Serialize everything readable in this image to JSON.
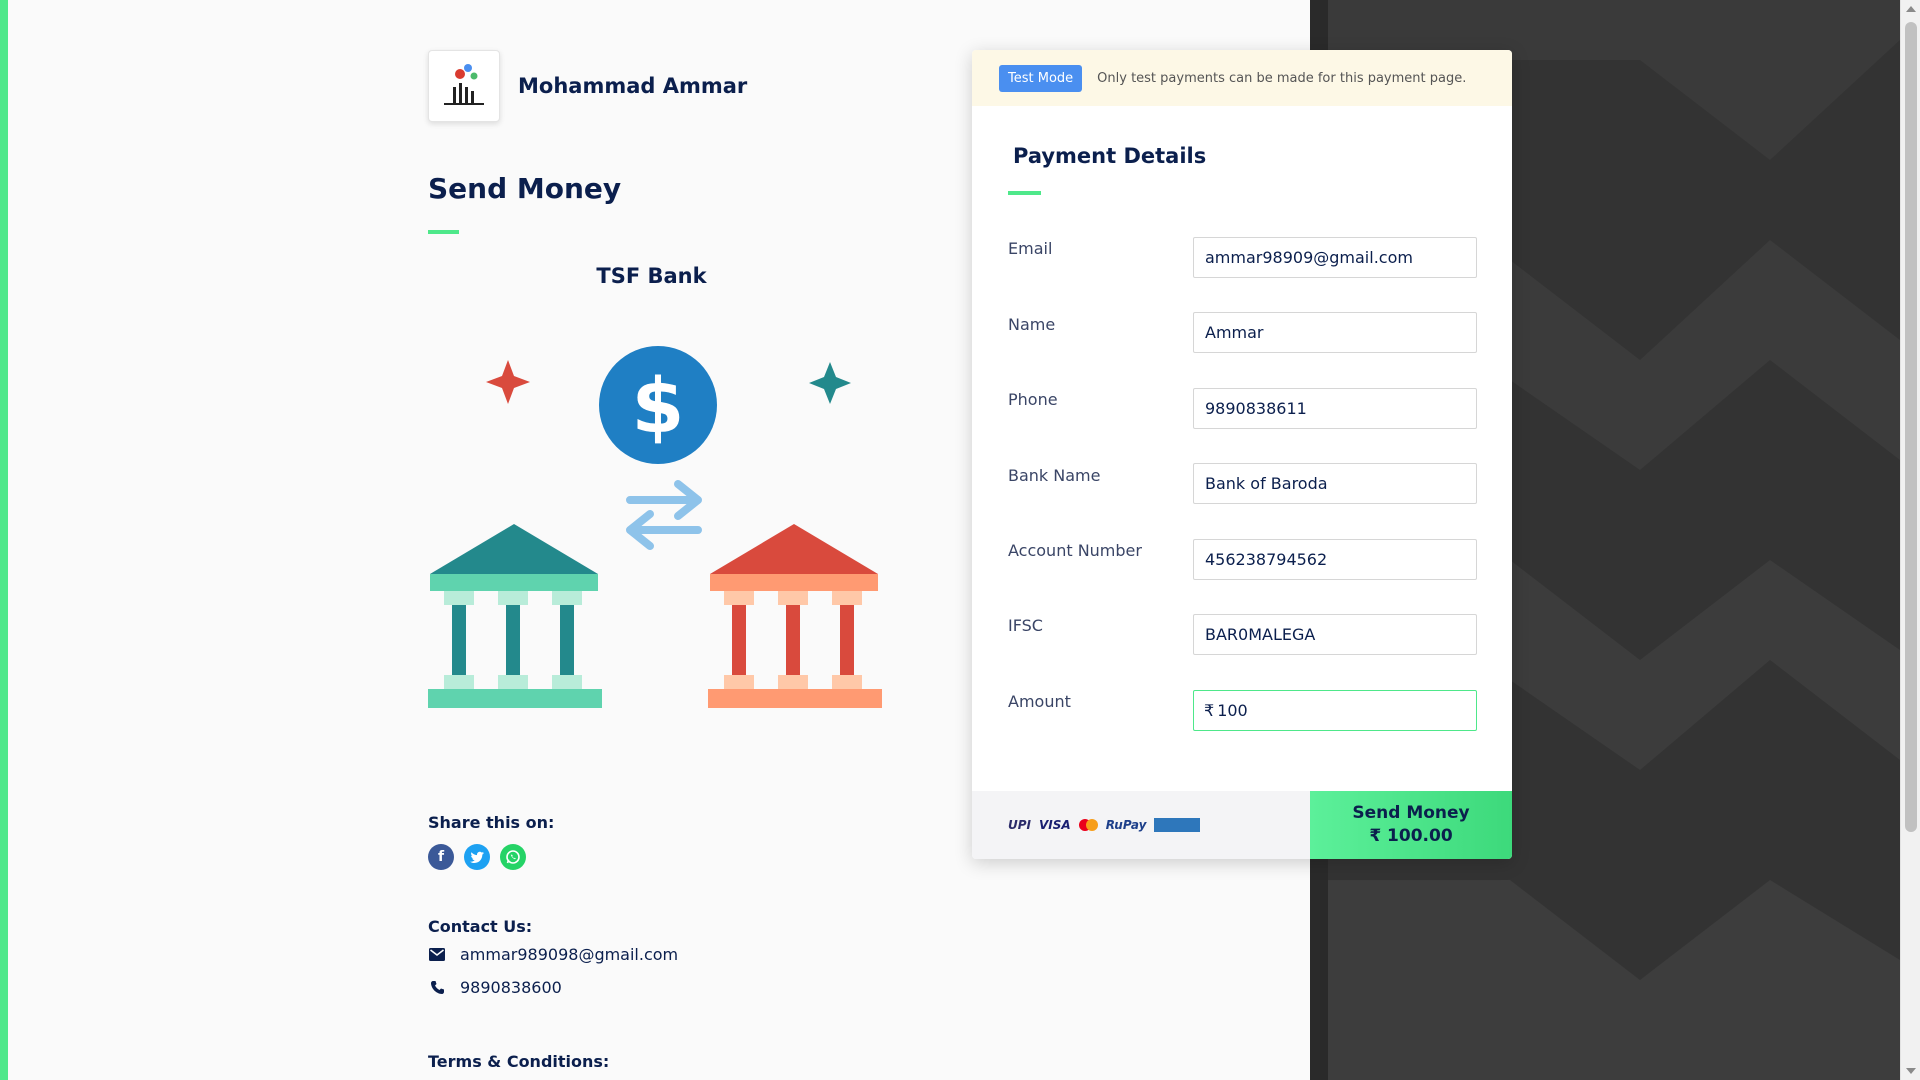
{
  "merchant": {
    "name": "Mohammad Ammar"
  },
  "page": {
    "title": "Send Money",
    "bank_name": "TSF Bank"
  },
  "share": {
    "label": "Share this on:",
    "icons": [
      "facebook-icon",
      "twitter-icon",
      "whatsapp-icon"
    ]
  },
  "contact": {
    "label": "Contact Us:",
    "email": "ammar989098@gmail.com",
    "phone": "9890838600"
  },
  "terms": {
    "label": "Terms & Conditions:"
  },
  "payment": {
    "test_badge": "Test Mode",
    "test_message": "Only test payments can be made for this payment page.",
    "title": "Payment Details",
    "fields": {
      "email": {
        "label": "Email",
        "value": "ammar98909@gmail.com"
      },
      "name": {
        "label": "Name",
        "value": "Ammar"
      },
      "phone": {
        "label": "Phone",
        "value": "9890838611"
      },
      "bank_name": {
        "label": "Bank Name",
        "value": "Bank of Baroda"
      },
      "account_number": {
        "label": "Account Number",
        "value": "456238794562"
      },
      "ifsc": {
        "label": "IFSC",
        "value": "BAR0MALEGA"
      },
      "amount": {
        "label": "Amount",
        "currency": "₹",
        "value": "100"
      }
    },
    "methods": {
      "upi": "UPI",
      "visa": "VISA",
      "rupay": "RuPay"
    },
    "button": {
      "label": "Send Money",
      "amount": "₹ 100.00"
    }
  },
  "colors": {
    "accent": "#4ee88a",
    "primary_text": "#0b1f4d",
    "badge": "#4a8ff0",
    "dark_bg": "#2a2a2a"
  }
}
